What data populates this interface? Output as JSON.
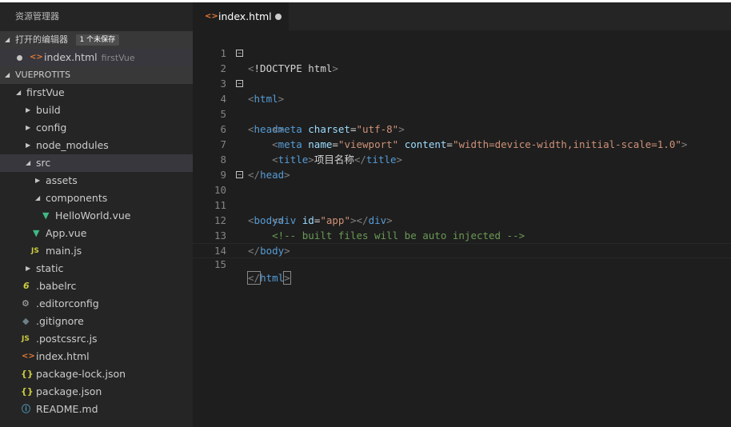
{
  "sidebar": {
    "title": "资源管理器",
    "open_editors": {
      "label": "打开的编辑器",
      "badge": "1 个未保存",
      "file": {
        "name": "index.html",
        "folder": "firstVue"
      }
    },
    "project": {
      "label": "VUEPROTITS",
      "tree": [
        {
          "label": "firstVue"
        },
        {
          "label": "build"
        },
        {
          "label": "config"
        },
        {
          "label": "node_modules"
        },
        {
          "label": "src"
        },
        {
          "label": "assets"
        },
        {
          "label": "components"
        },
        {
          "label": "HelloWorld.vue"
        },
        {
          "label": "App.vue"
        },
        {
          "label": "main.js"
        },
        {
          "label": "static"
        },
        {
          "label": ".babelrc"
        },
        {
          "label": ".editorconfig"
        },
        {
          "label": ".gitignore"
        },
        {
          "label": ".postcssrc.js"
        },
        {
          "label": "index.html"
        },
        {
          "label": "package-lock.json"
        },
        {
          "label": "package.json"
        },
        {
          "label": "README.md"
        }
      ]
    },
    "icons": {
      "html": "<>",
      "js": "JS",
      "json": "{}"
    }
  },
  "tab": {
    "label": "index.html",
    "icon": "<>"
  },
  "editor": {
    "line_numbers": [
      "1",
      "2",
      "3",
      "4",
      "5",
      "6",
      "7",
      "8",
      "9",
      "10",
      "11",
      "12",
      "13",
      "14",
      "15"
    ],
    "t": {
      "lt": "<",
      "gt": ">",
      "lts": "</",
      "eq": "=",
      "doctype": "!DOCTYPE",
      "html": "html",
      "head": "head",
      "meta": "meta",
      "title": "title",
      "body": "body",
      "div": "div",
      "charset": "charset",
      "name": "name",
      "content": "content",
      "id": "id",
      "v_utf8": "\"utf-8\"",
      "v_viewport": "\"viewport\"",
      "v_content": "\"width=device-width,initial-scale=1.0\"",
      "v_app": "\"app\"",
      "title_text": "项目名称",
      "comment": "<!-- built files will be auto injected -->"
    }
  },
  "colors": {
    "tag": "#569cd6",
    "attr": "#9cdcfe",
    "string": "#ce9178",
    "comment": "#6a9955",
    "punct": "#808080"
  }
}
